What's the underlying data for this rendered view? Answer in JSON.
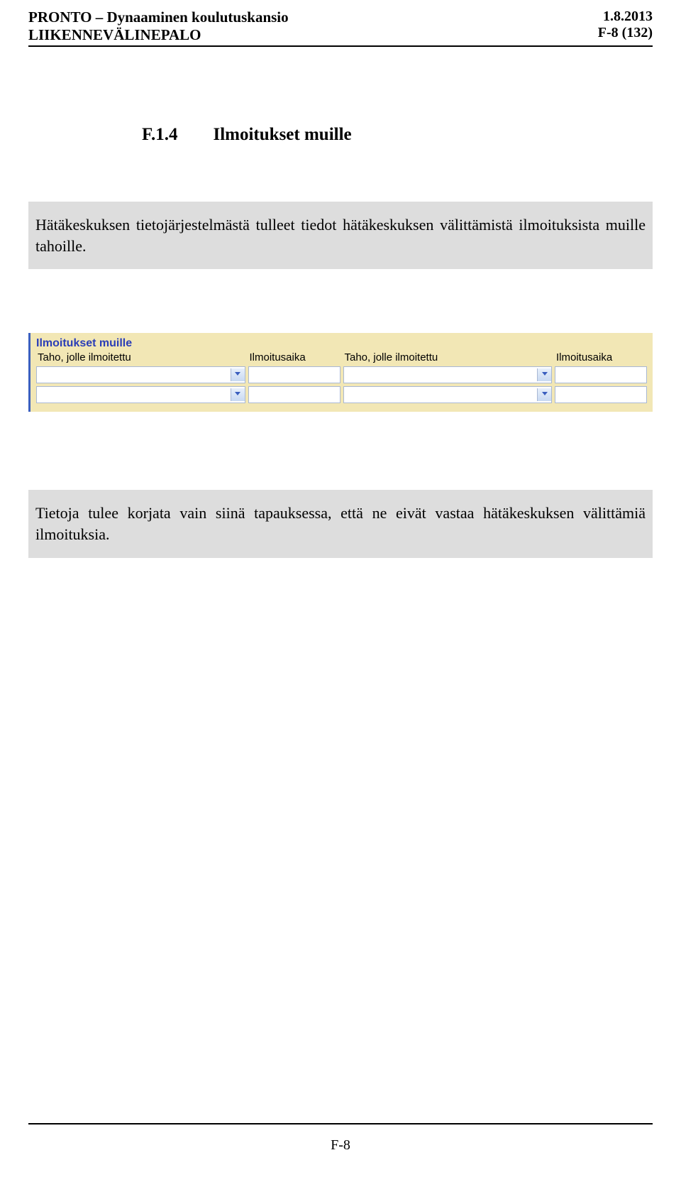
{
  "header": {
    "title_line1": "PRONTO – Dynaaminen koulutuskansio",
    "title_line2": "LIIKENNEVÄLINEPALO",
    "date": "1.8.2013",
    "page_ref": "F-8 (132)"
  },
  "section": {
    "number": "F.1.4",
    "title": "Ilmoitukset muille"
  },
  "info1": "Hätäkeskuksen tietojärjestelmästä tulleet tiedot hätäkeskuksen välittämistä ilmoituksista muille tahoille.",
  "info2": "Tietoja tulee korjata vain siinä tapauksessa, että ne eivät vastaa hätäkeskuksen välittämiä ilmoituksia.",
  "form": {
    "title": "Ilmoitukset muille",
    "headers": {
      "taho": "Taho, jolle ilmoitettu",
      "aika": "Ilmoitusaika",
      "taho2": "Taho, jolle ilmoitettu",
      "aika2": "Ilmoitusaika"
    },
    "rows": [
      {
        "taho1": "",
        "aika1": "",
        "taho2": "",
        "aika2": ""
      },
      {
        "taho1": "",
        "aika1": "",
        "taho2": "",
        "aika2": ""
      }
    ]
  },
  "footer": {
    "page": "F-8"
  }
}
